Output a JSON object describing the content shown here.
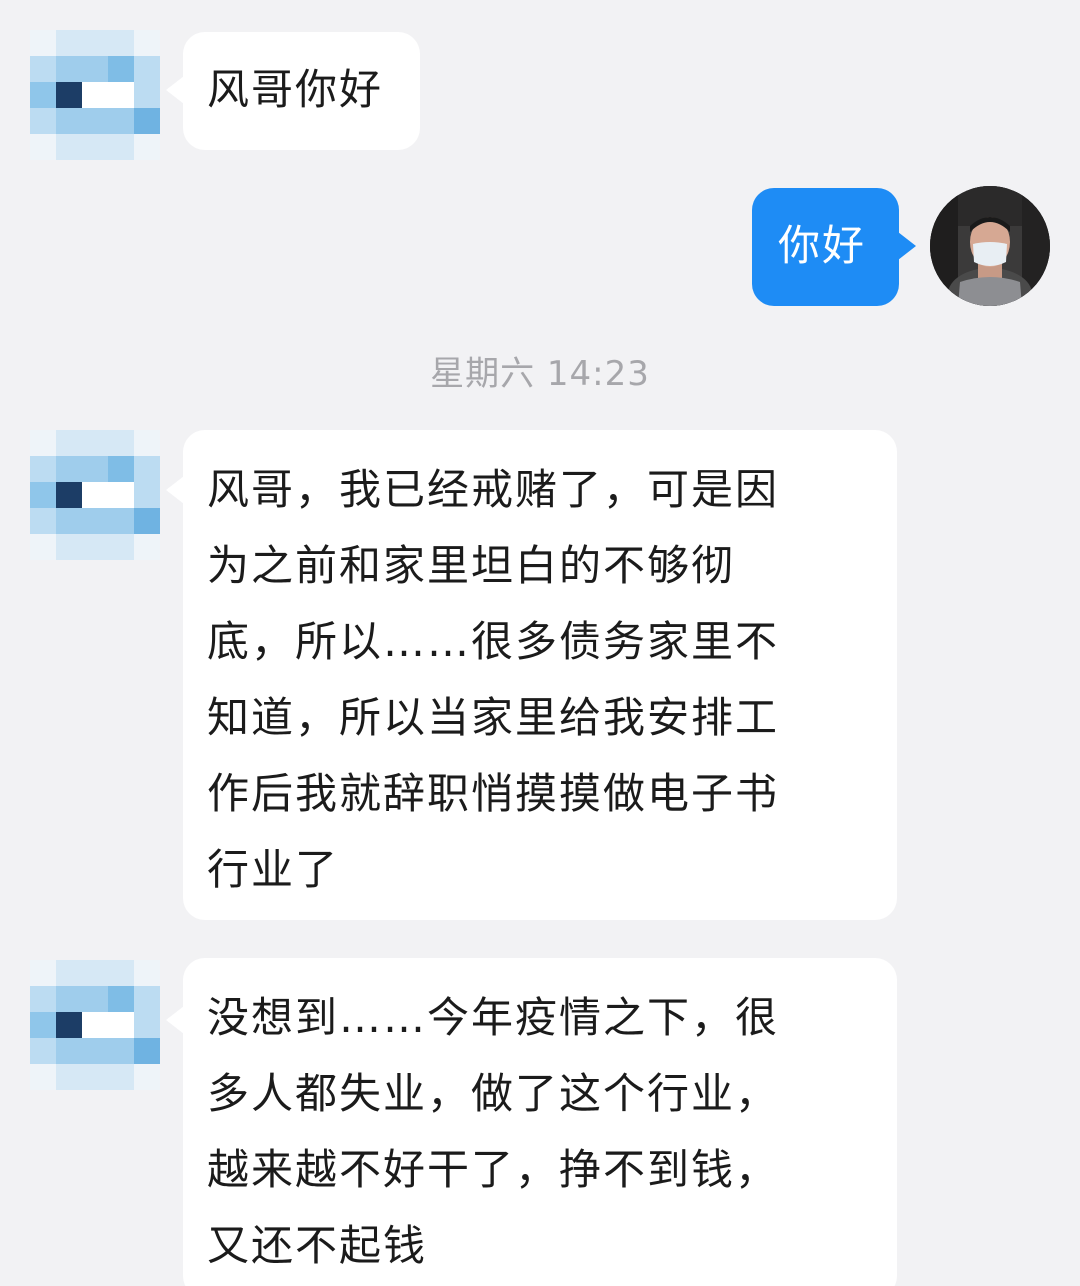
{
  "messages": [
    {
      "side": "incoming",
      "avatar": "pixelated-avatar",
      "lines": [
        "风哥你好"
      ]
    },
    {
      "side": "outgoing",
      "avatar": "user-photo-avatar",
      "lines": [
        "你好"
      ]
    },
    {
      "side": "incoming",
      "avatar": "pixelated-avatar",
      "lines": [
        "风哥，我已经戒赌了，可是因",
        "为之前和家里坦白的不够彻",
        "底，所以……很多债务家里不",
        "知道，所以当家里给我安排工",
        "作后我就辞职悄摸摸做电子书",
        "行业了"
      ]
    },
    {
      "side": "incoming",
      "avatar": "pixelated-avatar",
      "lines": [
        "没想到……今年疫情之下，很",
        "多人都失业，做了这个行业，",
        "越来越不好干了，挣不到钱，",
        "又还不起钱"
      ]
    }
  ],
  "timestamp": "星期六 14:23",
  "colors": {
    "background": "#f2f2f4",
    "incoming_bubble": "#ffffff",
    "outgoing_bubble": "#1e8cf5",
    "timestamp_text": "#a7a7ab"
  }
}
